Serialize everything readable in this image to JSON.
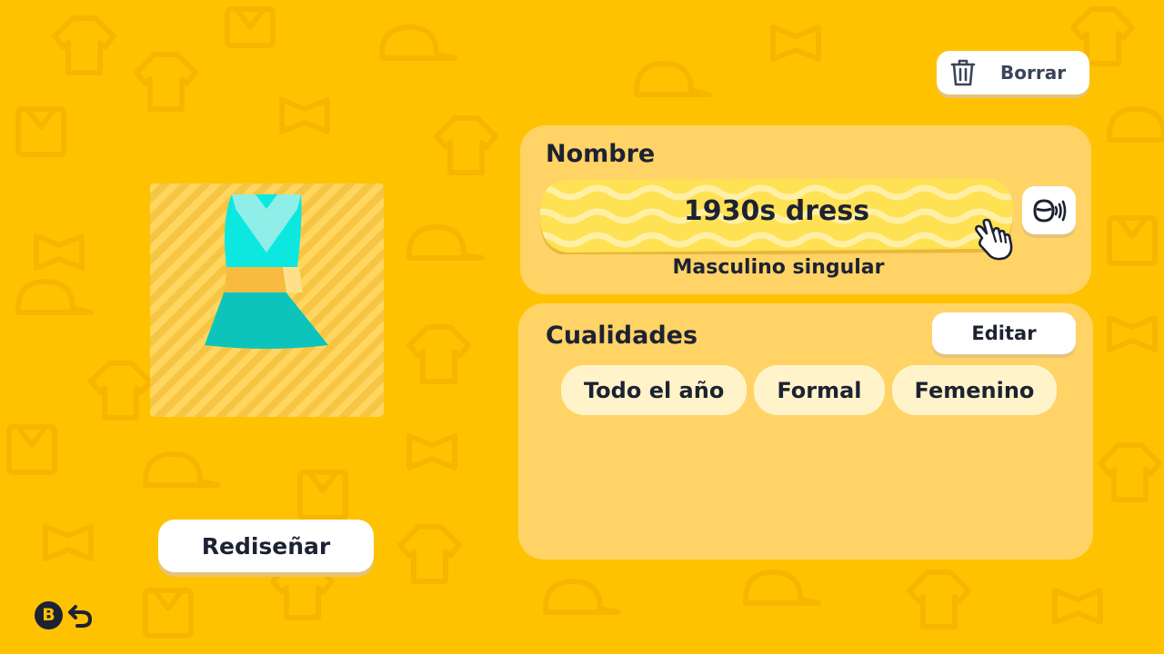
{
  "delete_button": {
    "label": "Borrar",
    "icon": "trash-icon"
  },
  "preview": {
    "item_icon": "dress-icon"
  },
  "redesign_button": {
    "label": "Rediseñar"
  },
  "back_control": {
    "button_glyph": "B",
    "icon": "back-arrow-icon"
  },
  "name_panel": {
    "heading": "Nombre",
    "name_value": "1930s dress",
    "gender_label": "Masculino singular",
    "voice_icon": "voice-icon",
    "pointer_icon": "hand-pointer-icon"
  },
  "qualities_panel": {
    "heading": "Cualidades",
    "edit_label": "Editar",
    "tags": [
      "Todo el año",
      "Formal",
      "Femenino"
    ]
  },
  "colors": {
    "background": "#ffc200",
    "panel": "#ffd366",
    "tag": "#fff4c9",
    "text": "#1d2233",
    "dress_top": "#0ce8e0",
    "dress_skirt": "#0cc4bc",
    "dress_band": "#f9bb3f"
  }
}
